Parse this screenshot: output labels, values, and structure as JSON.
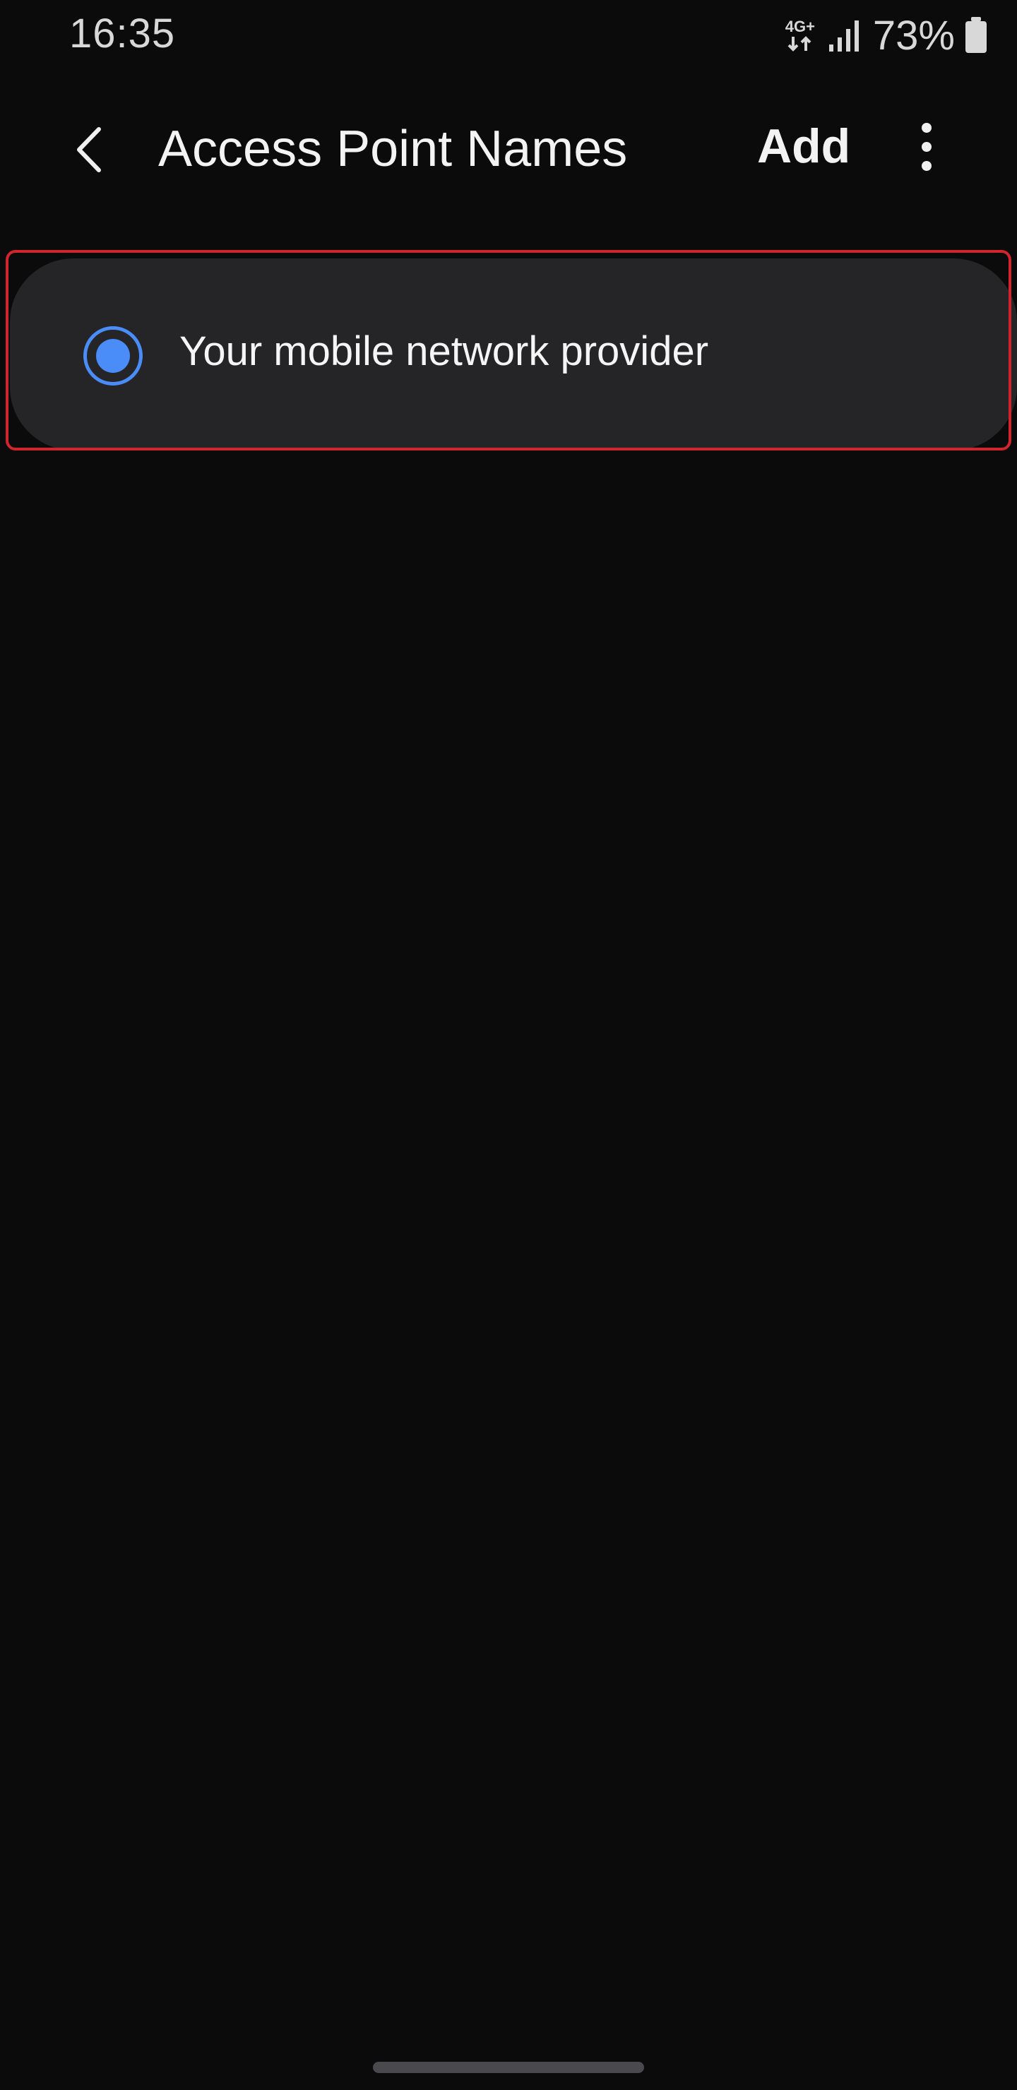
{
  "status_bar": {
    "time": "16:35",
    "network_type": "4G+",
    "battery_percent": "73%"
  },
  "app_bar": {
    "title": "Access Point Names",
    "add_label": "Add"
  },
  "apn_list": [
    {
      "name": "Your mobile network provider",
      "selected": true
    }
  ],
  "icons": {
    "back": "chevron-left-icon",
    "more": "more-vertical-icon",
    "signal": "signal-icon",
    "battery": "battery-icon",
    "data": "data-arrows-icon"
  },
  "colors": {
    "background": "#0b0b0c",
    "item_background": "#252527",
    "accent": "#4a8df8",
    "highlight": "#d0252e"
  }
}
